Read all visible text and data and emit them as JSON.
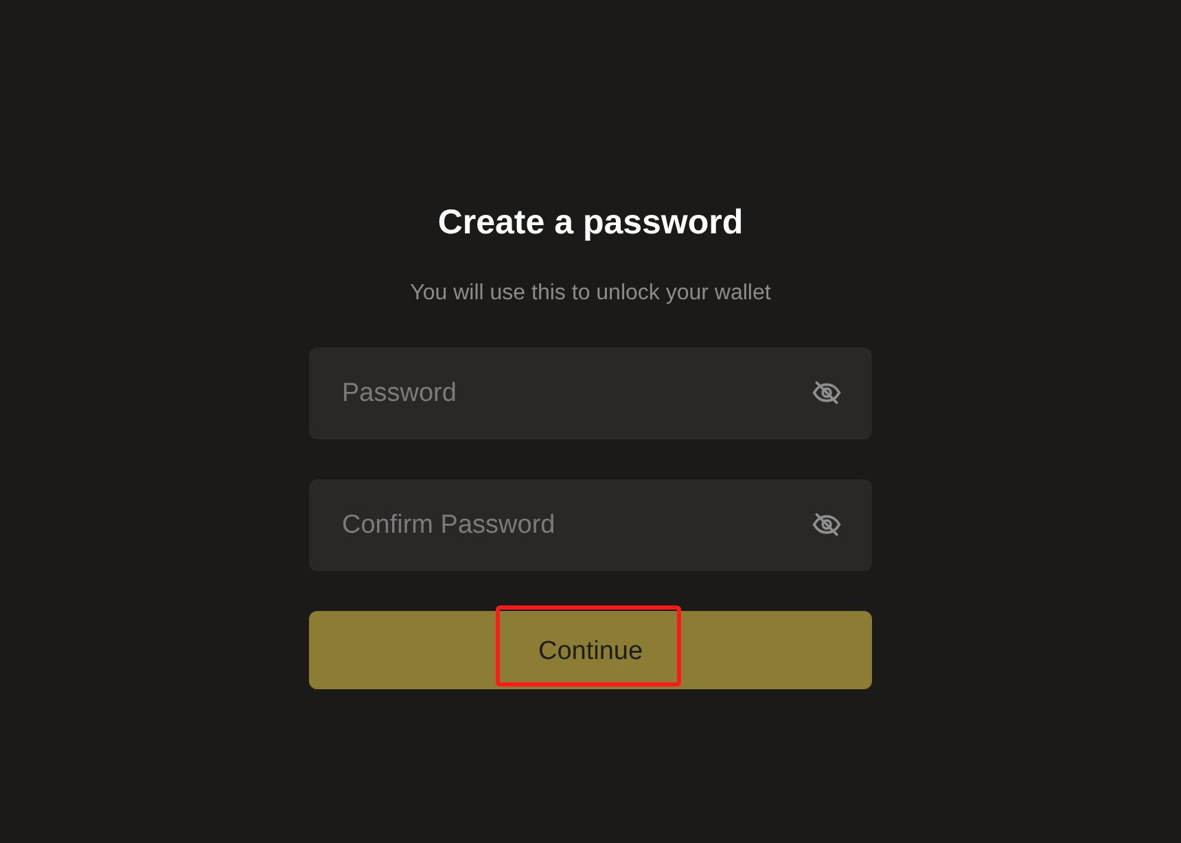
{
  "title": "Create a password",
  "subtitle": "You will use this to unlock your wallet",
  "fields": [
    {
      "placeholder": "Password"
    },
    {
      "placeholder": "Confirm Password"
    }
  ],
  "continue_button": {
    "label": "Continue",
    "highlighted": true
  }
}
